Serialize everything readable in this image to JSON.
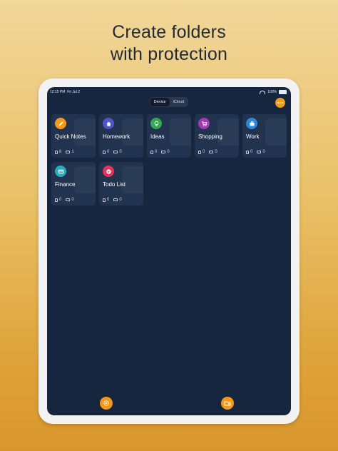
{
  "headline": {
    "line1": "Create folders",
    "line2": "with protection"
  },
  "status_bar": {
    "time": "12:15 PM",
    "date": "Fri Jul 2",
    "battery": "100%"
  },
  "storage_toggle": {
    "options": [
      "Device",
      "iCloud"
    ],
    "selected": "Device"
  },
  "folders": [
    {
      "name": "Quick Notes",
      "icon": "pencil-icon",
      "color": "#f39a1a",
      "notes": "8",
      "folders": "1"
    },
    {
      "name": "Homework",
      "icon": "home-icon",
      "color": "#4f56c9",
      "notes": "0",
      "folders": "0"
    },
    {
      "name": "Ideas",
      "icon": "lightbulb-icon",
      "color": "#35a852",
      "notes": "0",
      "folders": "0"
    },
    {
      "name": "Shopping",
      "icon": "cart-icon",
      "color": "#a23bb3",
      "notes": "0",
      "folders": "0"
    },
    {
      "name": "Work",
      "icon": "briefcase-icon",
      "color": "#2a87e0",
      "notes": "0",
      "folders": "0"
    },
    {
      "name": "Finance",
      "icon": "card-icon",
      "color": "#22aec3",
      "notes": "0",
      "folders": "0"
    },
    {
      "name": "Todo List",
      "icon": "check-icon",
      "color": "#e5325d",
      "notes": "0",
      "folders": "0"
    }
  ],
  "colors": {
    "accent": "#f39a1a",
    "screen_bg": "#17263f",
    "card_bg": "#223350"
  }
}
